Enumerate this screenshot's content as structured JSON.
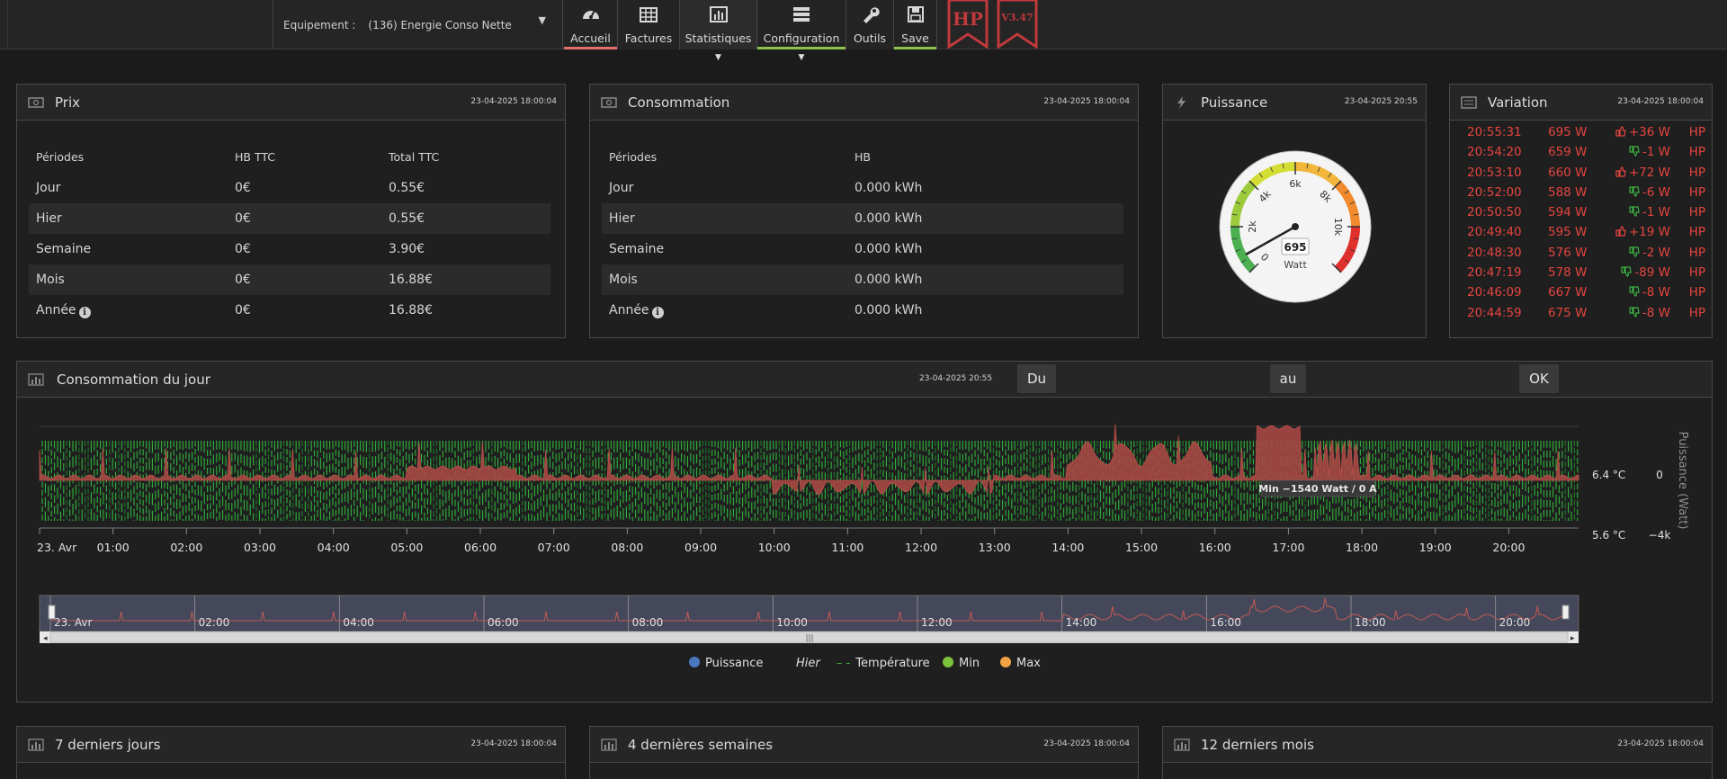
{
  "header": {
    "equipment_label": "Equipement :",
    "equipment_value": "(136) Energie Conso Nette",
    "nav": [
      {
        "label": "Accueil",
        "icon": "gauge-icon",
        "underline": "#e0706b"
      },
      {
        "label": "Factures",
        "icon": "table-icon",
        "underline": ""
      },
      {
        "label": "Statistiques",
        "icon": "bar-chart-icon",
        "underline": ""
      },
      {
        "label": "Configuration",
        "icon": "server-icon",
        "underline": "#8bc34a"
      },
      {
        "label": "Outils",
        "icon": "wrench-icon",
        "underline": ""
      },
      {
        "label": "Save",
        "icon": "floppy-icon",
        "underline": "#8bc34a"
      }
    ],
    "ribbon_hp": "HP",
    "ribbon_version": "V3.47"
  },
  "prix": {
    "title": "Prix",
    "date": "23-04-2025 18:00:04",
    "headers": [
      "Périodes",
      "HB TTC",
      "Total TTC"
    ],
    "rows": [
      [
        "Jour",
        "0€",
        "0.55€"
      ],
      [
        "Hier",
        "0€",
        "0.55€"
      ],
      [
        "Semaine",
        "0€",
        "3.90€"
      ],
      [
        "Mois",
        "0€",
        "16.88€"
      ],
      [
        "Année",
        "0€",
        "16.88€"
      ]
    ]
  },
  "consommation": {
    "title": "Consommation",
    "date": "23-04-2025 18:00:04",
    "headers": [
      "Périodes",
      "HB"
    ],
    "rows": [
      [
        "Jour",
        "0.000 kWh"
      ],
      [
        "Hier",
        "0.000 kWh"
      ],
      [
        "Semaine",
        "0.000 kWh"
      ],
      [
        "Mois",
        "0.000 kWh"
      ],
      [
        "Année",
        "0.000 kWh"
      ]
    ]
  },
  "puissance": {
    "title": "Puissance",
    "date": "23-04-2025 20:55",
    "value": "695",
    "value_num": 695,
    "unit": "Watt",
    "max": 12000,
    "ticks": [
      "0",
      "2k",
      "4k",
      "6k",
      "8k",
      "10k"
    ]
  },
  "variation": {
    "title": "Variation",
    "date": "23-04-2025 18:00:04",
    "rows": [
      {
        "time": "20:55:31",
        "power": "695 W",
        "delta": "+36 W",
        "dir": "up",
        "tarif": "HP"
      },
      {
        "time": "20:54:20",
        "power": "659 W",
        "delta": "-1 W",
        "dir": "down",
        "tarif": "HP"
      },
      {
        "time": "20:53:10",
        "power": "660 W",
        "delta": "+72 W",
        "dir": "up",
        "tarif": "HP"
      },
      {
        "time": "20:52:00",
        "power": "588 W",
        "delta": "-6 W",
        "dir": "down",
        "tarif": "HP"
      },
      {
        "time": "20:50:50",
        "power": "594 W",
        "delta": "-1 W",
        "dir": "down",
        "tarif": "HP"
      },
      {
        "time": "20:49:40",
        "power": "595 W",
        "delta": "+19 W",
        "dir": "up",
        "tarif": "HP"
      },
      {
        "time": "20:48:30",
        "power": "576 W",
        "delta": "-2 W",
        "dir": "down",
        "tarif": "HP"
      },
      {
        "time": "20:47:19",
        "power": "578 W",
        "delta": "-89 W",
        "dir": "down",
        "tarif": "HP"
      },
      {
        "time": "20:46:09",
        "power": "667 W",
        "delta": "-8 W",
        "dir": "down",
        "tarif": "HP"
      },
      {
        "time": "20:44:59",
        "power": "675 W",
        "delta": "-8 W",
        "dir": "down",
        "tarif": "HP"
      }
    ]
  },
  "daily": {
    "title": "Consommation du jour",
    "date": "23-04-2025 20:55",
    "btn_du": "Du",
    "btn_au": "au",
    "btn_ok": "OK",
    "tooltip": "Min −1540 Watt / 0 A",
    "y_right_title": "Puissance (Watt)",
    "y_temp_labels": [
      "6.4 °C",
      "5.6 °C"
    ],
    "y_power_labels": [
      "0",
      "−4k"
    ],
    "x_labels": [
      "23. Avr",
      "01:00",
      "02:00",
      "03:00",
      "04:00",
      "05:00",
      "06:00",
      "07:00",
      "08:00",
      "09:00",
      "10:00",
      "11:00",
      "12:00",
      "13:00",
      "14:00",
      "15:00",
      "16:00",
      "17:00",
      "18:00",
      "19:00",
      "20:00"
    ],
    "nav_labels": [
      "23. Avr",
      "02:00",
      "04:00",
      "06:00",
      "08:00",
      "10:00",
      "12:00",
      "14:00",
      "16:00",
      "18:00",
      "20:00"
    ],
    "legend": [
      {
        "label": "Puissance",
        "color": "#4a78c0",
        "kind": "dot"
      },
      {
        "label": "Hier",
        "color": "",
        "kind": "italic"
      },
      {
        "label": "Température",
        "color": "#3cb043",
        "kind": "dash"
      },
      {
        "label": "Min",
        "color": "#7cc43c",
        "kind": "dot"
      },
      {
        "label": "Max",
        "color": "#f2a444",
        "kind": "dot"
      }
    ]
  },
  "bottom": [
    {
      "title": "7 derniers jours",
      "date": "23-04-2025 18:00:04"
    },
    {
      "title": "4 dernières semaines",
      "date": "23-04-2025 18:00:04"
    },
    {
      "title": "12 derniers mois",
      "date": "23-04-2025 18:00:04"
    }
  ]
}
